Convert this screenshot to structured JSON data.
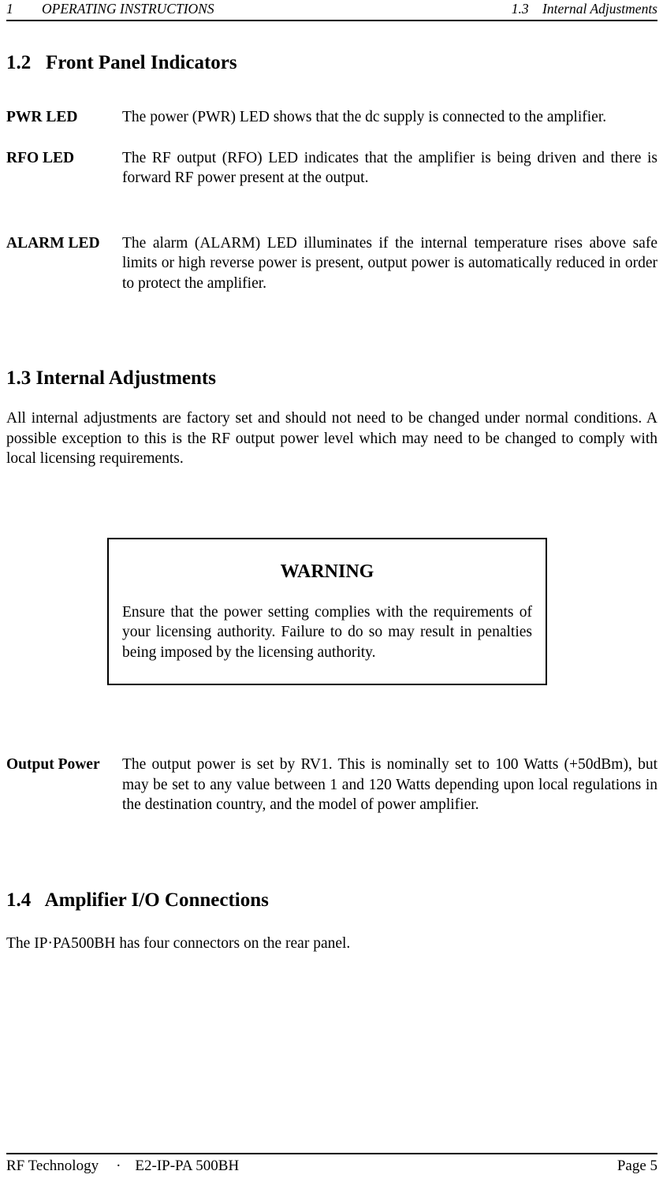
{
  "header": {
    "chapter_number": "1",
    "chapter_title": "OPERATING INSTRUCTIONS",
    "section_number": "1.3",
    "section_title": "Internal Adjustments"
  },
  "sections": {
    "front_panel": {
      "heading": "1.2   Front Panel Indicators",
      "items": [
        {
          "term": "PWR LED",
          "description": "The power (PWR) LED shows that the dc supply is connected to the amplifier."
        },
        {
          "term": "RFO LED",
          "description": "The RF output (RFO) LED indicates that the amplifier is being driven and there is forward RF power present at the output."
        },
        {
          "term": "ALARM LED",
          "description": "The alarm (ALARM) LED illuminates if the internal temperature rises above safe limits or high reverse power is present, output power is automatically reduced in order to protect the amplifier."
        }
      ]
    },
    "internal_adjustments": {
      "heading": "1.3 Internal Adjustments",
      "intro": "All internal adjustments are factory set and should not need to be changed under normal conditions. A possible exception to this is the RF output power level which may need to be changed to comply with local licensing requirements.",
      "warning": {
        "title": "WARNING",
        "body": "Ensure that the power setting complies with the requirements of your licensing authority. Failure to do so may result in penalties being imposed by the licensing authority."
      },
      "output_power": {
        "term": "Output Power",
        "description": "The output power is set by RV1. This is nominally set to 100 Watts (+50dBm), but may be set to any value between 1 and 120 Watts depending upon local regulations in the destination country, and the model of power amplifier."
      }
    },
    "amplifier_io": {
      "heading": "1.4   Amplifier I/O Connections",
      "intro": "The IP·PA500BH has four connectors on the rear panel."
    }
  },
  "footer": {
    "company": "RF Technology",
    "separator": "·",
    "model": "E2-IP-PA 500BH",
    "page_label": "Page 5"
  }
}
